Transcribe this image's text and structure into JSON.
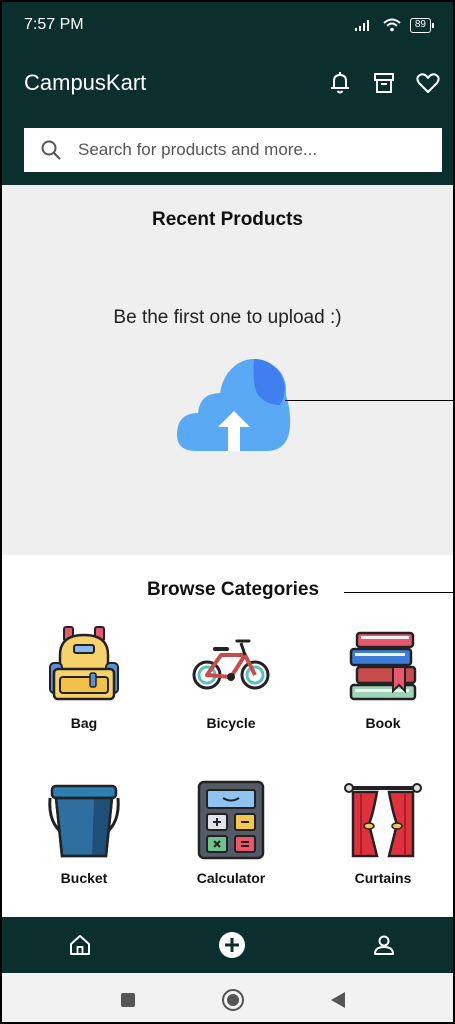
{
  "status_bar": {
    "time": "7:57 PM",
    "battery": "89"
  },
  "app_bar": {
    "title": "CampusKart",
    "icons": [
      "bell-icon",
      "archive-icon",
      "heart-icon"
    ]
  },
  "search": {
    "placeholder": "Search for products and more..."
  },
  "recent_products": {
    "title": "Recent Products",
    "empty_message": "Be the first one to upload :)"
  },
  "browse_categories": {
    "title": "Browse Categories",
    "items": [
      {
        "label": "Bag",
        "icon": "bag-icon"
      },
      {
        "label": "Bicycle",
        "icon": "bicycle-icon"
      },
      {
        "label": "Book",
        "icon": "book-icon"
      },
      {
        "label": "Bucket",
        "icon": "bucket-icon"
      },
      {
        "label": "Calculator",
        "icon": "calculator-icon"
      },
      {
        "label": "Curtains",
        "icon": "curtains-icon"
      }
    ]
  },
  "bottom_nav": {
    "icons": [
      "home-icon",
      "add-icon",
      "profile-icon"
    ]
  },
  "system_nav": {
    "icons": [
      "square-icon",
      "circle-icon",
      "back-triangle-icon"
    ]
  },
  "colors": {
    "primary": "#0b2f2c",
    "accent_blue": "#5aa9f5",
    "section_bg": "#efefef"
  }
}
